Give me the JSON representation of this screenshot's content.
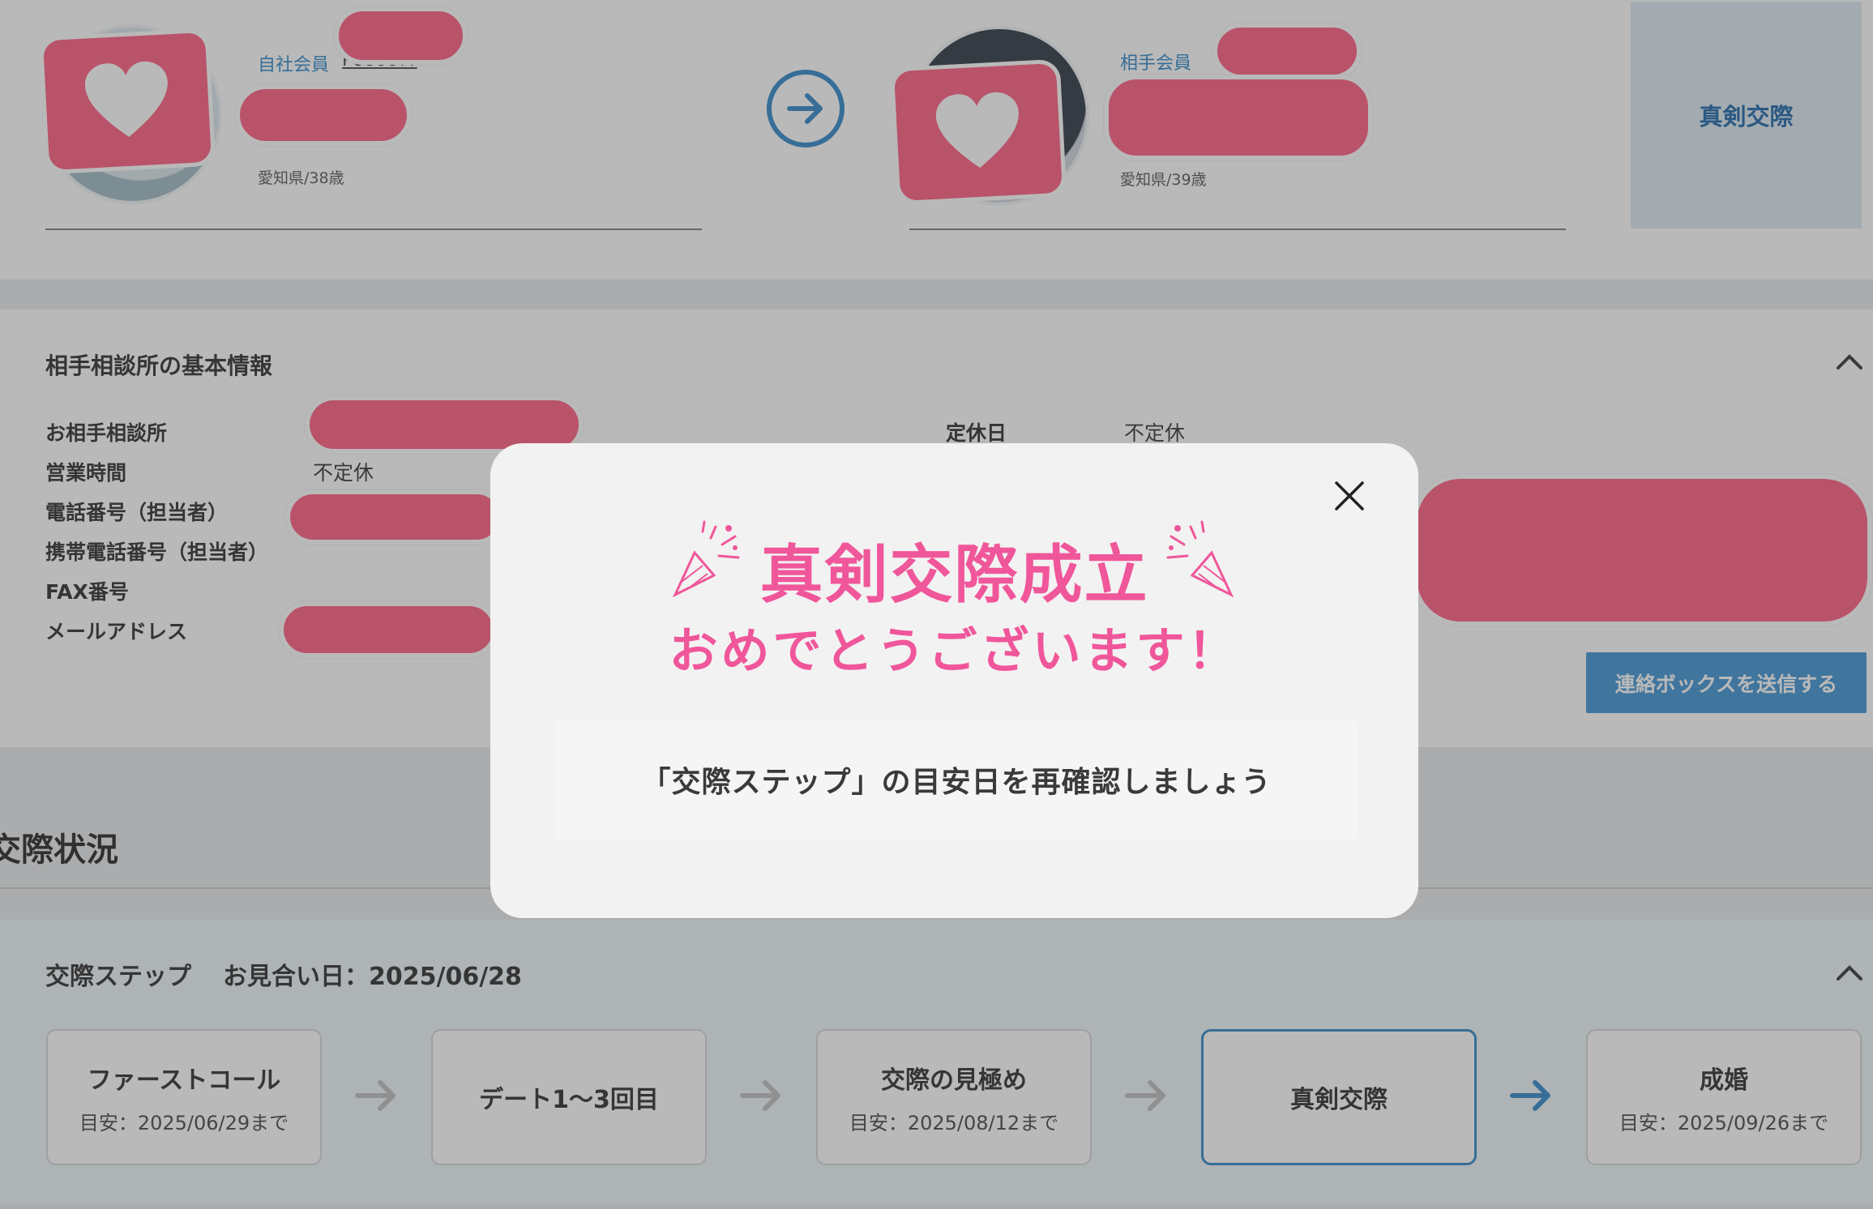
{
  "member_card": {
    "own_label": "自社会員",
    "own_id": "P0000??",
    "own_meta": "愛知県/38歳",
    "partner_label": "相手会員",
    "partner_meta": "愛知県/39歳",
    "status": "真剣交際"
  },
  "basic_info": {
    "title": "相手相談所の基本情報",
    "rows_left": [
      {
        "label": "お相手相談所",
        "value": ""
      },
      {
        "label": "営業時間",
        "value": "不定休"
      },
      {
        "label": "電話番号（担当者）",
        "value": ""
      },
      {
        "label": "携帯電話番号（担当者）",
        "value": ""
      },
      {
        "label": "FAX番号",
        "value": ""
      },
      {
        "label": "メールアドレス",
        "value": ""
      }
    ],
    "holiday_label": "定休日",
    "holiday_value": "不定休",
    "send_button": "連絡ボックスを送信する"
  },
  "status_section": {
    "heading": "交際状況"
  },
  "steps": {
    "heading": "交際ステップ",
    "meeting_date": "お見合い日：2025/06/28",
    "items": [
      {
        "title": "ファーストコール",
        "sub": "目安：2025/06/29まで"
      },
      {
        "title": "デート1〜3回目",
        "sub": ""
      },
      {
        "title": "交際の見極め",
        "sub": "目安：2025/08/12まで"
      },
      {
        "title": "真剣交際",
        "sub": ""
      },
      {
        "title": "成婚",
        "sub": "目安：2025/09/26まで"
      }
    ]
  },
  "modal": {
    "title": "真剣交際成立",
    "subtitle": "おめでとうございます！",
    "message": "「交際ステップ」の目安日を再確認しましょう"
  },
  "colors": {
    "accent_blue": "#2e86c8",
    "celebration_pink": "#f0569a",
    "redaction_pink": "#ff5b7f"
  }
}
